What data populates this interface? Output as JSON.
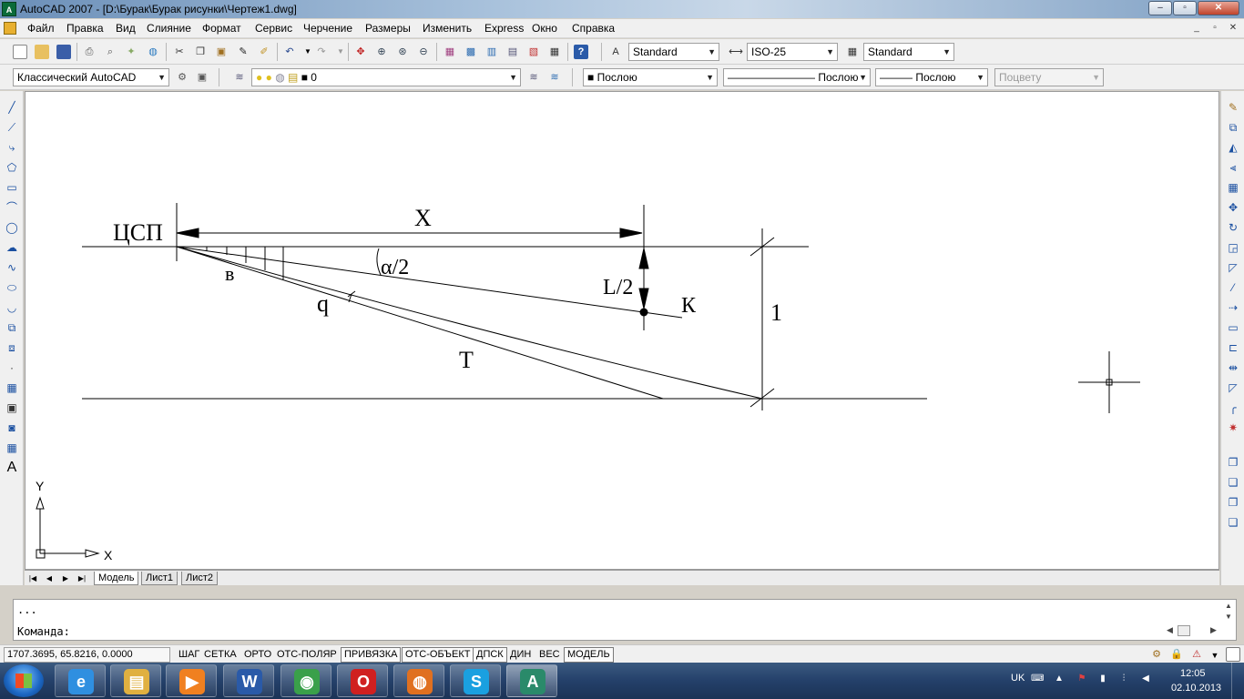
{
  "window": {
    "title": "AutoCAD 2007 - [D:\\Бурак\\Бурак рисунки\\Чертеж1.dwg]",
    "app_icon": "autocad-icon",
    "controls": {
      "minimize": "–",
      "maximize": "▫",
      "close": "✕"
    }
  },
  "menu": {
    "items": [
      "Файл",
      "Правка",
      "Вид",
      "Слияние",
      "Формат",
      "Сервис",
      "Черчение",
      "Размеры",
      "Изменить",
      "Express",
      "Окно",
      "Справка"
    ],
    "mdi_controls": {
      "minimize": "_",
      "restore": "▫",
      "close": "✕"
    }
  },
  "toolbar1": {
    "text_style": "Standard",
    "dim_style": "ISO-25",
    "table_style": "Standard"
  },
  "toolbar2": {
    "workspace": "Классический AutoCAD",
    "layer": "0",
    "color": "Послою",
    "linetype": "Послою",
    "lineweight": "Послою",
    "plotstyle": "Поцвету"
  },
  "drawing": {
    "labels": {
      "csp": "ЦСП",
      "x": "X",
      "alpha": "α/2",
      "v": "в",
      "q": "q",
      "l2": "L/2",
      "k": "К",
      "t": "T",
      "one": "1"
    },
    "ucs": {
      "x": "X",
      "y": "Y"
    }
  },
  "layout_tabs": {
    "nav": [
      "|◀",
      "◀",
      "▶",
      "▶|"
    ],
    "tabs": [
      "Модель",
      "Лист1",
      "Лист2"
    ],
    "active": "Модель"
  },
  "command": {
    "history": "...",
    "prompt": "Команда:"
  },
  "status": {
    "coords": "1707.3695, 65.8216, 0.0000",
    "buttons": [
      "ШАГ",
      "СЕТКА",
      "ОРТО",
      "ОТС-ПОЛЯР",
      "ПРИВЯЗКА",
      "ОТС-ОБЪЕКТ",
      "ДПСК",
      "ДИН",
      "ВЕС",
      "МОДЕЛЬ"
    ],
    "on_buttons": [
      "ПРИВЯЗКА",
      "ОТС-ОБЪЕКТ",
      "ДПСК",
      "МОДЕЛЬ"
    ]
  },
  "taskbar": {
    "apps": [
      {
        "name": "internet-explorer",
        "glyph": "e",
        "color": "#2f8fe0"
      },
      {
        "name": "file-explorer",
        "glyph": "▤",
        "color": "#e0b040"
      },
      {
        "name": "media-player",
        "glyph": "▶",
        "color": "#f08020"
      },
      {
        "name": "word",
        "glyph": "W",
        "color": "#2a5aa8"
      },
      {
        "name": "chrome",
        "glyph": "◉",
        "color": "#3aa04a"
      },
      {
        "name": "opera",
        "glyph": "O",
        "color": "#d02020"
      },
      {
        "name": "firefox",
        "glyph": "◍",
        "color": "#e07020"
      },
      {
        "name": "skype",
        "glyph": "S",
        "color": "#1aa0e0"
      },
      {
        "name": "autocad",
        "glyph": "A",
        "color": "#2a8a6a"
      }
    ],
    "lang": "UK",
    "time": "12:05",
    "date": "02.10.2013"
  }
}
